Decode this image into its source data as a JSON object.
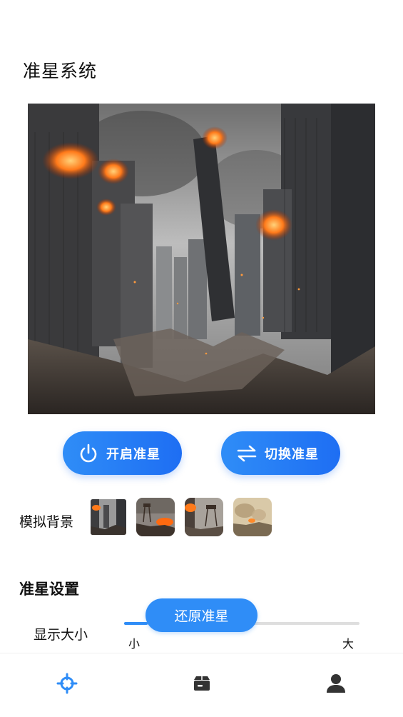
{
  "page": {
    "title": "准星系统"
  },
  "hero": {
    "description_icon": "city-ruins-image"
  },
  "actions": {
    "power_label": "开启准星",
    "switch_label": "切换准星",
    "power_icon": "power-icon",
    "switch_icon": "swap-arrows-icon",
    "accent": "#2f8df7"
  },
  "background": {
    "label": "模拟背景",
    "thumbnails": [
      "city-ruins-thumb",
      "watchtower-fire-thumb",
      "watchtower-ruins-thumb",
      "desert-battle-thumb"
    ],
    "selected_index": 0
  },
  "settings": {
    "section_title": "准星设置",
    "size_label": "显示大小",
    "slider_min_label": "小",
    "slider_max_label": "大",
    "slider_value": 0.1,
    "reset_label": "还原准星"
  },
  "tabbar": {
    "items": [
      {
        "icon": "crosshair-icon",
        "active": true,
        "color": "#2f8df7"
      },
      {
        "icon": "box-icon",
        "active": false,
        "color": "#333333"
      },
      {
        "icon": "user-icon",
        "active": false,
        "color": "#333333"
      }
    ]
  }
}
